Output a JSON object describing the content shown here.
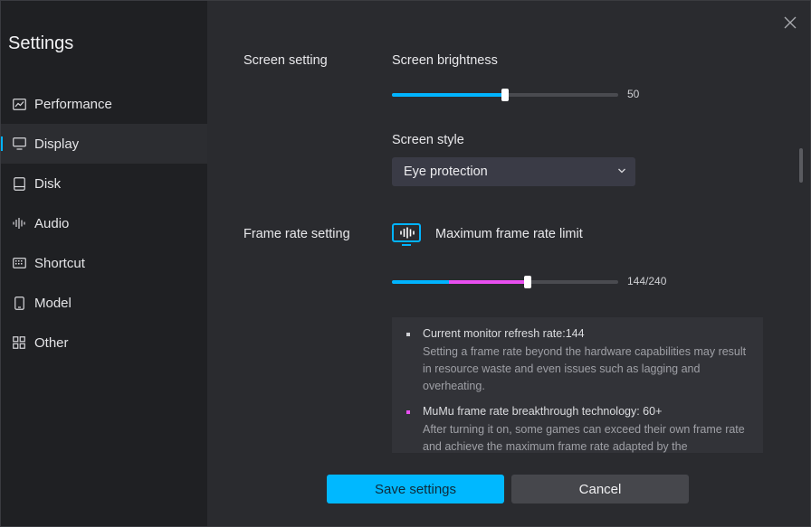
{
  "sidebar": {
    "title": "Settings",
    "items": [
      {
        "label": "Performance",
        "icon": "chart-icon"
      },
      {
        "label": "Display",
        "icon": "monitor-icon",
        "active": true
      },
      {
        "label": "Disk",
        "icon": "disk-icon"
      },
      {
        "label": "Audio",
        "icon": "audio-wave-icon"
      },
      {
        "label": "Shortcut",
        "icon": "keyboard-icon"
      },
      {
        "label": "Model",
        "icon": "phone-icon"
      },
      {
        "label": "Other",
        "icon": "grid-icon"
      }
    ]
  },
  "screen": {
    "section_label": "Screen setting",
    "brightness_label": "Screen brightness",
    "brightness_value": "50",
    "brightness_fraction": 0.5,
    "style_label": "Screen style",
    "style_value": "Eye protection"
  },
  "frame_rate": {
    "section_label": "Frame rate setting",
    "limit_label": "Maximum frame rate limit",
    "value_text": "144/240",
    "value": 144,
    "max": 240,
    "breakthrough_start": 60
  },
  "info": {
    "item1_head": "Current monitor refresh rate:144",
    "item1_body": "Setting a frame rate beyond the hardware capabilities may result in resource waste and even issues such as lagging and overheating.",
    "item2_head": "MuMu frame rate breakthrough technology: 60+",
    "item2_body": "After turning it on, some games can exceed their own frame rate and achieve the maximum frame rate adapted by the"
  },
  "buttons": {
    "save": "Save settings",
    "cancel": "Cancel"
  },
  "colors": {
    "accent": "#00b4ff",
    "breakthrough": "#e84ff0"
  }
}
